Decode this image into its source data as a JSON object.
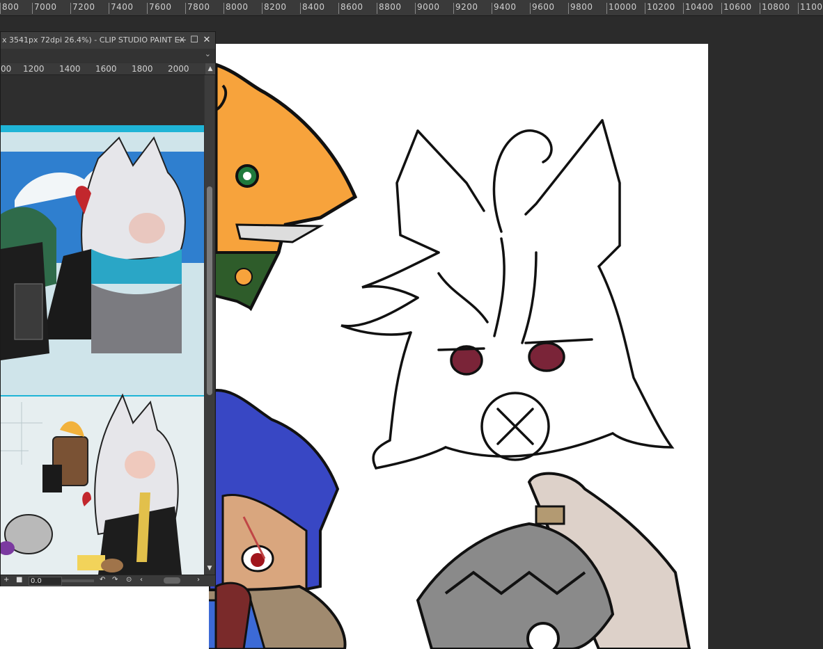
{
  "app": {
    "window_title": "x 3541px 72dpi 26.4%)  - CLIP STUDIO PAINT EX"
  },
  "top_ruler": {
    "labels": [
      "800",
      "7000",
      "7200",
      "7400",
      "7600",
      "7800",
      "8000",
      "8200",
      "8400",
      "8600",
      "8800",
      "9000",
      "9200",
      "9400",
      "9600",
      "9800",
      "10000",
      "10200",
      "10400",
      "10600",
      "10800",
      "1100"
    ]
  },
  "sub_window": {
    "ruler_labels": [
      "00",
      "1200",
      "1400",
      "1600",
      "1800",
      "2000"
    ],
    "zoom_value": "0.0",
    "minimize_glyph": "—",
    "maximize_glyph": "☐",
    "close_glyph": "✕"
  },
  "icons": {
    "minimize": "minimize-icon",
    "maximize": "maximize-icon",
    "close": "close-icon",
    "rotate_left": "rotate-left-icon",
    "rotate_right": "rotate-right-icon",
    "reset": "reset-rotation-icon"
  },
  "colors": {
    "workspace_bg": "#2b2b2b",
    "paper": "#ffffff",
    "panel": "#323232",
    "accent_cyan": "#1fb4d6"
  }
}
